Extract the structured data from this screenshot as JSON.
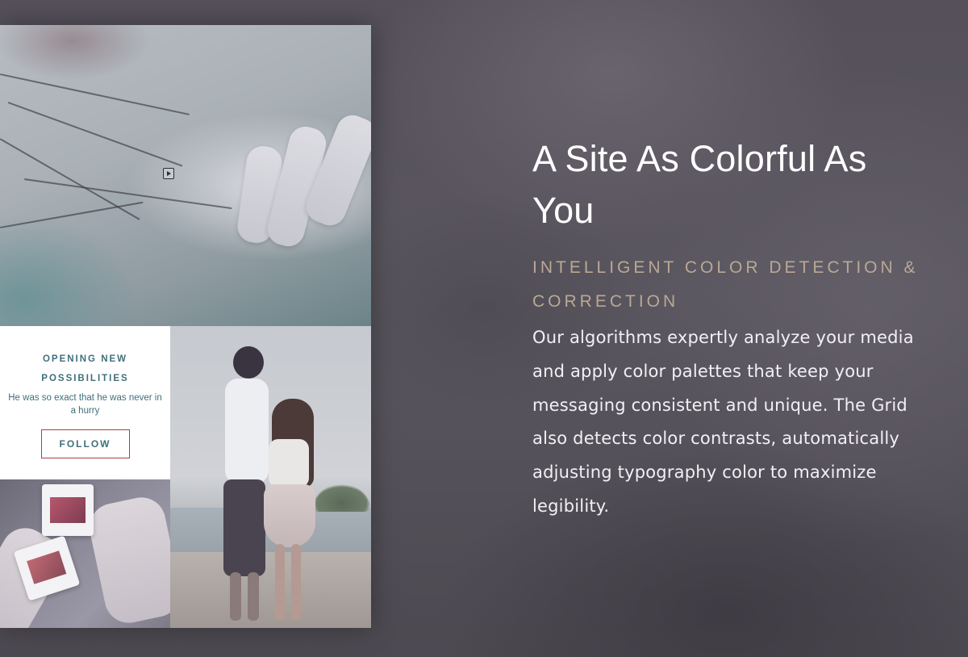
{
  "mockup": {
    "card": {
      "heading": "OPENING NEW POSSIBILITIES",
      "subtext": "He was so exact that he was never in a hurry",
      "button_label": "FOLLOW"
    },
    "icons": {
      "video": "play-icon"
    }
  },
  "feature": {
    "title": "A Site As Colorful As You",
    "subtitle": "INTELLIGENT COLOR DETECTION & CORRECTION",
    "description": "Our algorithms expertly analyze your media and apply color palettes that keep your messaging consistent and unique. The Grid also detects color contrasts, automatically adjusting typography color to maximize legibility."
  },
  "colors": {
    "accent_teal": "#3f6f7a",
    "button_border": "#a5423e",
    "subtitle_tan": "#b9a894",
    "background": "#55505a"
  }
}
